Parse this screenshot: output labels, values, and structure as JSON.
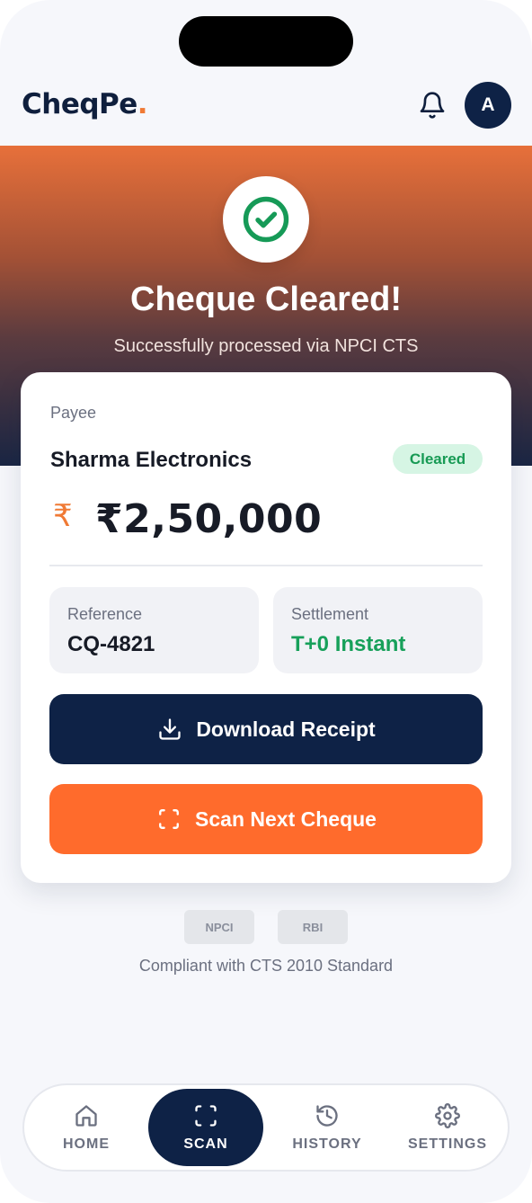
{
  "app": {
    "logo_text": "CheqPe",
    "logo_dot": "."
  },
  "header": {
    "avatar_initial": "A",
    "notification_icon": "bell-icon"
  },
  "hero": {
    "title": "Cheque Cleared!",
    "subtitle": "Successfully processed via NPCI CTS",
    "status_icon": "check-circle-icon"
  },
  "card": {
    "payee_label": "Payee",
    "payee_name": "Sharma Electronics",
    "status_badge": "Cleared",
    "currency_symbol": "₹",
    "amount": "₹2,50,000",
    "reference": {
      "label": "Reference",
      "value": "CQ-4821"
    },
    "settlement": {
      "label": "Settlement",
      "value": "T+0 Instant"
    },
    "download_button": "Download Receipt",
    "scan_button": "Scan Next Cheque"
  },
  "compliance": {
    "chips": [
      "NPCI",
      "RBI"
    ],
    "text": "Compliant with CTS 2010 Standard"
  },
  "bottom_nav": {
    "items": [
      {
        "label": "HOME",
        "icon": "home-icon"
      },
      {
        "label": "SCAN",
        "icon": "scan-icon"
      },
      {
        "label": "HISTORY",
        "icon": "history-icon"
      },
      {
        "label": "SETTINGS",
        "icon": "gear-icon"
      }
    ],
    "active": "SCAN"
  },
  "colors": {
    "navy": "#0e2246",
    "orange": "#ff6b2c",
    "accent_orange": "#f07a35",
    "success_green": "#17a05a",
    "badge_bg": "#d6f5e4"
  }
}
